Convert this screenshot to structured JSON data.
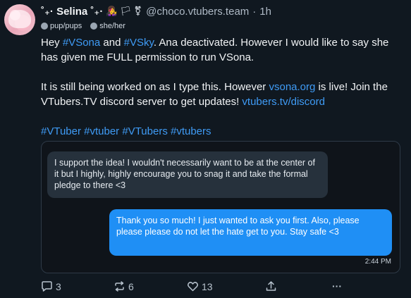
{
  "post": {
    "display_name": "˚₊· Selina ˚₊·",
    "emoji_decor": "👩‍🎤 🏳 ⚧",
    "handle": "@choco.vtubers.team",
    "separator": "·",
    "time": "1h",
    "pronouns": [
      {
        "label": "pup/pups",
        "icon": "pronoun-icon"
      },
      {
        "label": "she/her",
        "icon": "pronoun-icon"
      }
    ],
    "paragraph1": {
      "t1": "Hey ",
      "tag1": "#VSona",
      "t2": " and ",
      "tag2": "#VSky",
      "t3": ". Ana deactivated. However I would like to say she has given me FULL permission to run VSona."
    },
    "paragraph2": {
      "t1": "It is still being worked on as I type this. However ",
      "link1": "vsona.org",
      "t2": " is live! Join the VTubers.TV discord server to get updates! ",
      "link2": "vtubers.tv/discord"
    },
    "hashtags": "#VTuber #vtuber #VTubers #vtubers",
    "attachment": {
      "message_left": "I support the idea! I wouldn't necessarily want to be at the center of it but I highly, highly encourage you to snag it and take the formal pledge to there <3",
      "message_right": "Thank you so much! I just wanted to ask you first. Also, please please please do not let the hate get to you. Stay safe <3",
      "message_time": "2:44 PM"
    },
    "actions": {
      "replies": "3",
      "reposts": "6",
      "likes": "13",
      "share_icon": "share-icon",
      "more_label": "···"
    }
  },
  "colors": {
    "background": "#101820",
    "link": "#3f9bf5",
    "bubble_sent": "#1f8ff5",
    "bubble_received": "#26313c"
  }
}
